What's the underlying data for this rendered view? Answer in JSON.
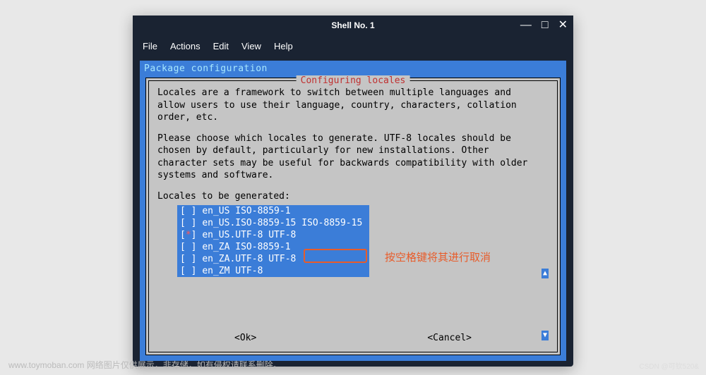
{
  "window": {
    "title": "Shell No. 1",
    "controls": {
      "min": "—",
      "max": "□",
      "close": "✕"
    }
  },
  "menubar": [
    "File",
    "Actions",
    "Edit",
    "View",
    "Help"
  ],
  "package_header": "Package configuration",
  "dialog": {
    "title": "Configuring locales",
    "para1": "Locales are a framework to switch between multiple languages and\nallow users to use their language, country, characters, collation\norder, etc.",
    "para2": "Please choose which locales to generate. UTF-8 locales should be\nchosen by default, particularly for new installations. Other\ncharacter sets may be useful for backwards compatibility with older\nsystems and software.",
    "prompt": "Locales to be generated:",
    "items": [
      {
        "checked": false,
        "label": "en_US ISO-8859-1"
      },
      {
        "checked": false,
        "label": "en_US.ISO-8859-15 ISO-8859-15"
      },
      {
        "checked": true,
        "label": "en_US.UTF-8 UTF-8"
      },
      {
        "checked": false,
        "label": "en_ZA ISO-8859-1"
      },
      {
        "checked": false,
        "label": "en_ZA.UTF-8 UTF-8"
      },
      {
        "checked": false,
        "label": "en_ZM UTF-8"
      }
    ],
    "ok": "<Ok>",
    "cancel": "<Cancel>"
  },
  "annotation": {
    "text": "按空格键将其进行取消"
  },
  "watermark": "www.toymoban.com 网络图片仅供展示，非存储，如有侵权请联系删除。",
  "csdn": "CSDN @可钦520&"
}
